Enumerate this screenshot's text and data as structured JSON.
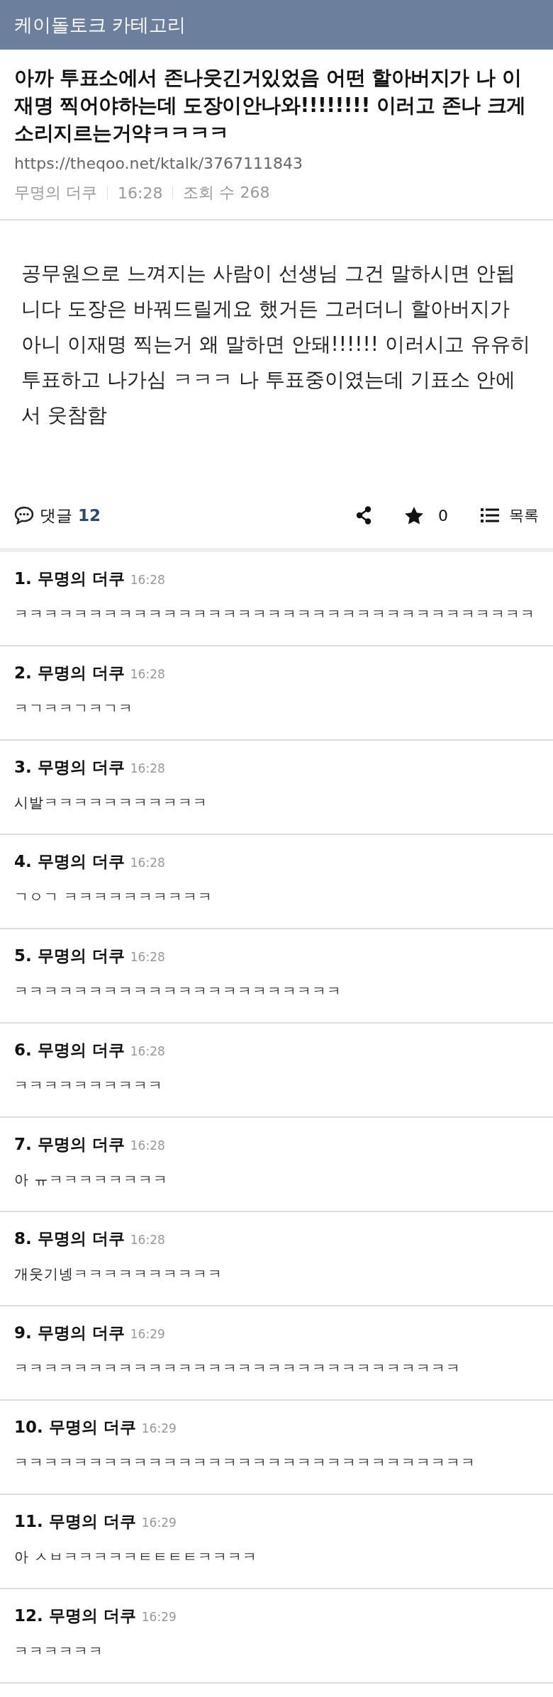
{
  "header": {
    "title": "케이돌토크 카테고리"
  },
  "post": {
    "title": "아까 투표소에서 존나웃긴거있었음 어떤 할아버지가 나 이재명 찍어야하는데 도장이안나와!!!!!!!! 이러고 존나 크게 소리지르는거약ㅋㅋㅋㅋ",
    "url": "https://theqoo.net/ktalk/3767111843",
    "author": "무명의 더쿠",
    "time": "16:28",
    "views": "조회 수 268",
    "body": "공무원으로 느껴지는 사람이 선생님 그건 말하시면 안됩니다 도장은 바꿔드릴게요 했거든 그러더니 할아버지가 아니 이재명 찍는거 왜 말하면 안돼!!!!!! 이러시고 유유히 투표하고 나가심 ㅋㅋㅋ 나 투표중이였는데 기표소 안에서 웃참함"
  },
  "actions": {
    "comments_label": "댓글",
    "comments_count": "12",
    "star_count": "0",
    "list_label": "목록"
  },
  "comments": [
    {
      "number": "1.",
      "author": "무명의 더쿠",
      "time": "16:28",
      "text": "ㅋㅋㅋㅋㅋㅋㅋㅋㅋㅋㅋㅋㅋㅋㅋㅋㅋㅋㅋㅋㅋㅋㅋㅋㅋㅋㅋㅋㅋㅋㅋㅋㅋㅋㅋ"
    },
    {
      "number": "2.",
      "author": "무명의 더쿠",
      "time": "16:28",
      "text": "ㅋㄱㅋㅋㄱㅋㄱㅋ"
    },
    {
      "number": "3.",
      "author": "무명의 더쿠",
      "time": "16:28",
      "text": "시발ㅋㅋㅋㅋㅋㅋㅋㅋㅋㅋㅋ"
    },
    {
      "number": "4.",
      "author": "무명의 더쿠",
      "time": "16:28",
      "text": "ㄱㅇㄱ ㅋㅋㅋㅋㅋㅋㅋㅋㅋㅋ"
    },
    {
      "number": "5.",
      "author": "무명의 더쿠",
      "time": "16:28",
      "text": "ㅋㅋㅋㅋㅋㅋㅋㅋㅋㅋㅋㅋㅋㅋㅋㅋㅋㅋㅋㅋㅋㅋ"
    },
    {
      "number": "6.",
      "author": "무명의 더쿠",
      "time": "16:28",
      "text": "ㅋㅋㅋㅋㅋㅋㅋㅋㅋㅋ"
    },
    {
      "number": "7.",
      "author": "무명의 더쿠",
      "time": "16:28",
      "text": "아 ㅠㅋㅋㅋㅋㅋㅋㅋㅋ"
    },
    {
      "number": "8.",
      "author": "무명의 더쿠",
      "time": "16:28",
      "text": "개웃기넹ㅋㅋㅋㅋㅋㅋㅋㅋㅋㅋ"
    },
    {
      "number": "9.",
      "author": "무명의 더쿠",
      "time": "16:29",
      "text": "ㅋㅋㅋㅋㅋㅋㅋㅋㅋㅋㅋㅋㅋㅋㅋㅋㅋㅋㅋㅋㅋㅋㅋㅋㅋㅋㅋㅋㅋㅋ"
    },
    {
      "number": "10.",
      "author": "무명의 더쿠",
      "time": "16:29",
      "text": "ㅋㅋㅋㅋㅋㅋㅋㅋㅋㅋㅋㅋㅋㅋㅋㅋㅋㅋㅋㅋㅋㅋㅋㅋㅋㅋㅋㅋㅋㅋㅋ"
    },
    {
      "number": "11.",
      "author": "무명의 더쿠",
      "time": "16:29",
      "text": "아 ㅅㅂㅋㅋㅋㅋㅋㅌㅌㅌㅌㅋㅋㅋㅋ"
    },
    {
      "number": "12.",
      "author": "무명의 더쿠",
      "time": "16:29",
      "text": "ㅋㅋㅋㅋㅋㅋ"
    }
  ]
}
